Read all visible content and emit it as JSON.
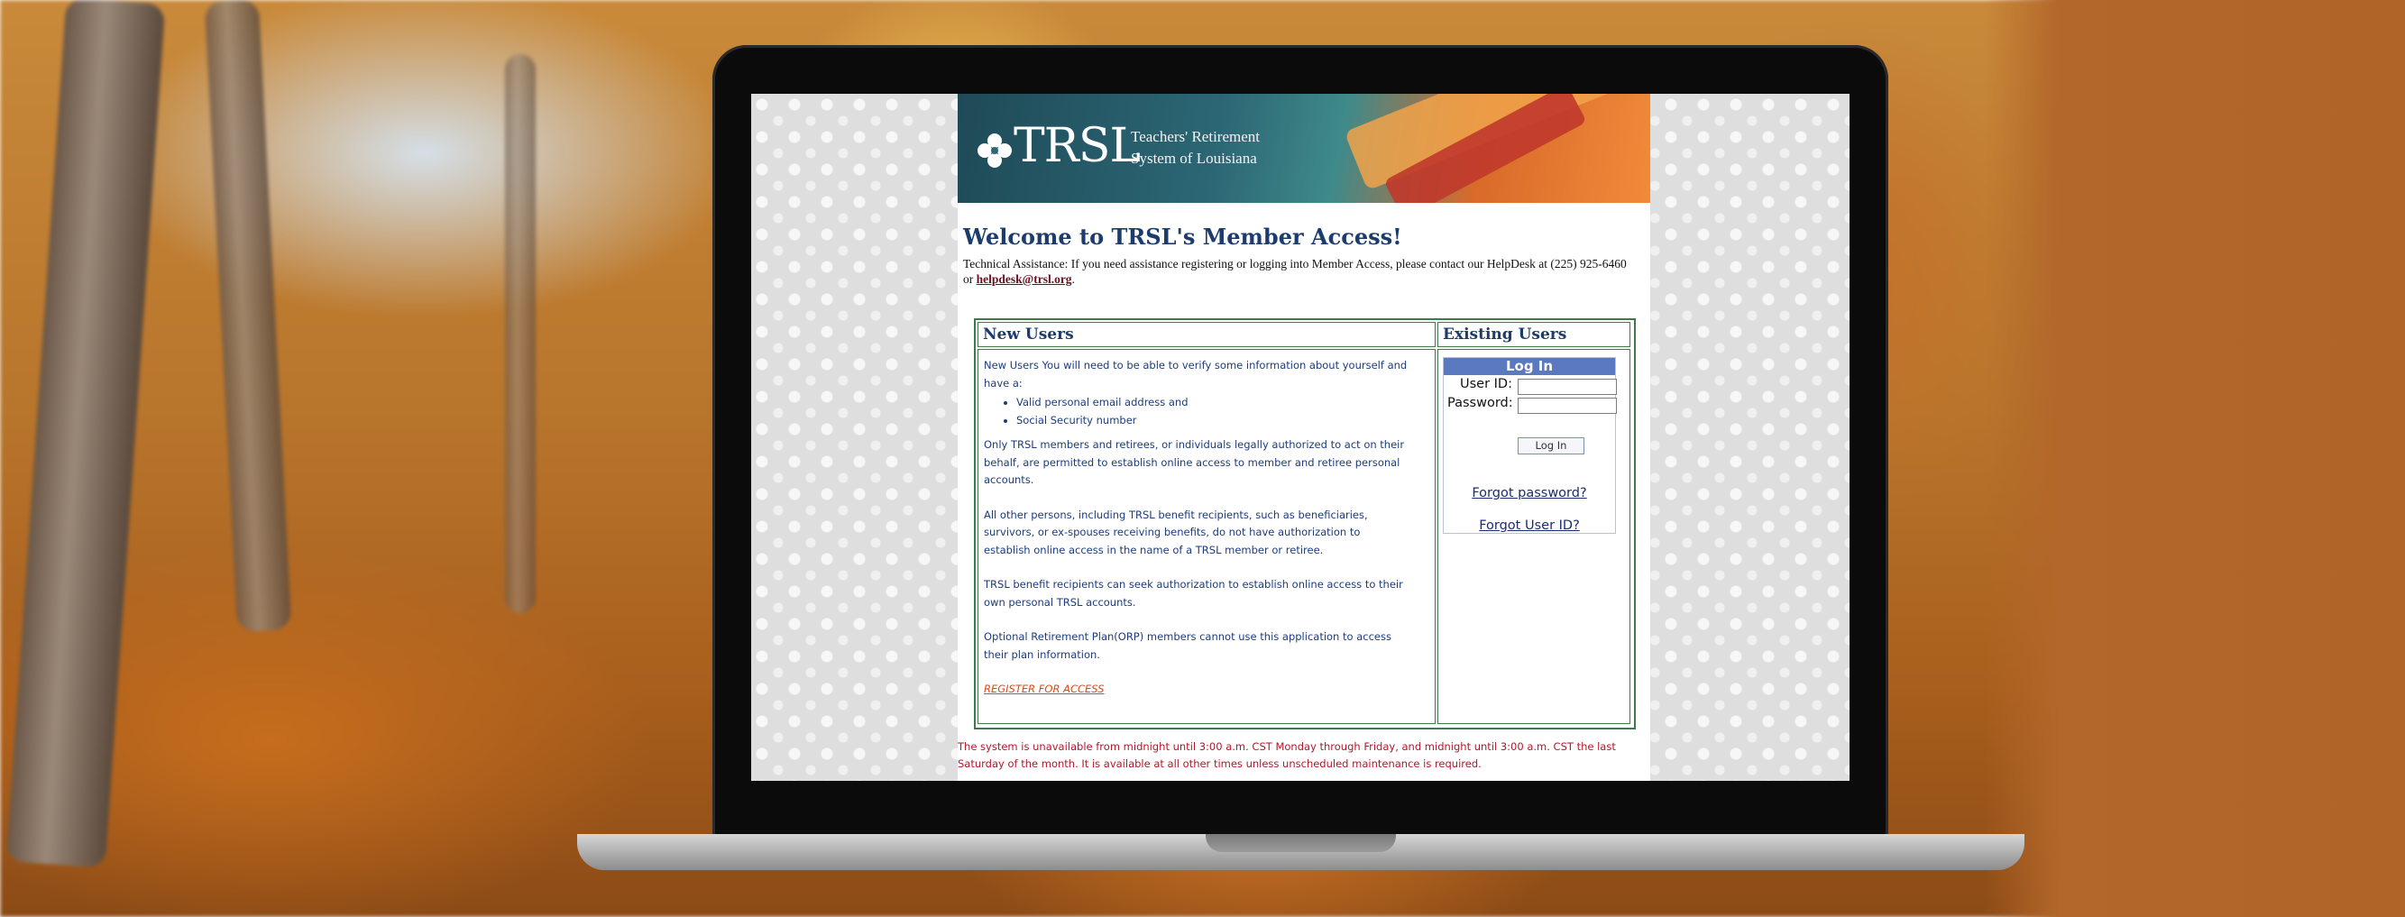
{
  "page": {
    "banner": {
      "logo": "TRSL",
      "subtitle_line1": "Teachers' Retirement",
      "subtitle_line2": "System of Louisiana"
    },
    "title": "Welcome to TRSL's Member Access!",
    "tech_assist": {
      "text": "Technical Assistance: If you need assistance registering or logging into Member Access, please contact our HelpDesk at (225) 925-6460 or",
      "email": "helpdesk@trsl.org",
      "end": "."
    },
    "new_users": {
      "heading": "New Users",
      "intro": "New Users You will need to be able to verify some information about yourself and have a:",
      "items": [
        "Valid personal email address and",
        "Social Security number"
      ],
      "para1": "Only TRSL members and retirees, or individuals legally authorized to act on their behalf, are permitted to establish online access to member and retiree personal accounts.",
      "para2": "All other persons, including TRSL benefit recipients, such as beneficiaries, survivors, or ex-spouses receiving benefits, do not have authorization to establish online access in the name of a TRSL member or retiree.",
      "para3": "TRSL benefit recipients can seek authorization to establish online access to their own personal TRSL accounts.",
      "para4": "Optional Retirement Plan(ORP) members cannot use this application to access their plan information.",
      "register_link": "REGISTER FOR ACCESS"
    },
    "existing_users": {
      "heading": "Existing Users",
      "login_header": "Log In",
      "user_id_label": "User ID:",
      "password_label": "Password:",
      "user_id_value": "",
      "password_value": "",
      "login_button": "Log In",
      "forgot_password": "Forgot password?",
      "forgot_user_id": "Forgot User ID?"
    },
    "notice": "The system is unavailable from midnight until 3:00 a.m. CST Monday through Friday, and midnight until 3:00 a.m. CST the last Saturday of the month. It is available at all other times unless unscheduled maintenance is required."
  },
  "colors": {
    "accent": "#1c3c6e",
    "border": "#3e7a4a",
    "login_header": "#5b79be",
    "warning": "#b0182a"
  }
}
